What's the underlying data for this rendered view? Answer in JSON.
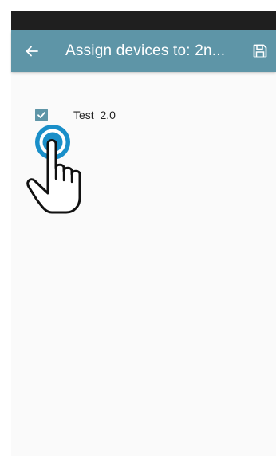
{
  "app_bar": {
    "title": "Assign devices to: 2n...",
    "back_icon": "arrow-left-icon",
    "save_icon": "floppy-disk-icon",
    "background_color": "#5e95a7",
    "text_color": "#ffffff"
  },
  "status_bar": {
    "background_color": "#1f1f1f"
  },
  "devices": [
    {
      "label": "Test_2.0",
      "checked": true
    }
  ],
  "cursor": {
    "icon": "hand-pointer-icon",
    "ring_color": "#1a8fc9"
  }
}
